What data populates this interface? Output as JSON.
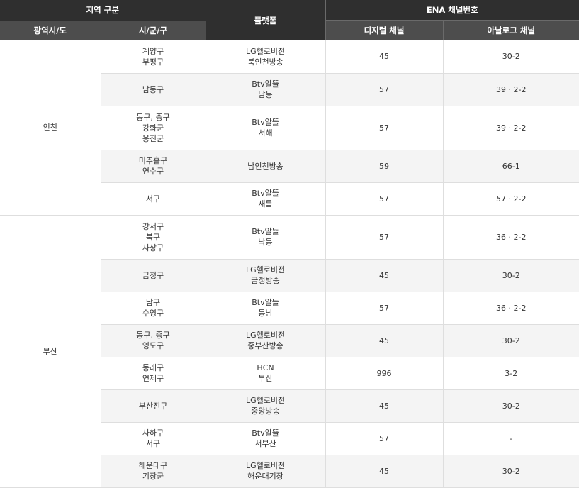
{
  "header": {
    "region_group": "지역 구분",
    "platform": "플랫폼",
    "channel_group": "ENA 채널번호",
    "province": "광역시/도",
    "district": "시/군/구",
    "digital": "디지털 채널",
    "analog": "아날로그 채널"
  },
  "regions": [
    {
      "name": "인천",
      "rows": [
        {
          "district": [
            "계양구",
            "부평구"
          ],
          "platform": [
            "LG헬로비전",
            "북인천방송"
          ],
          "digital": "45",
          "analog": "30-2"
        },
        {
          "district": [
            "남동구"
          ],
          "platform": [
            "Btv알뜰",
            "남동"
          ],
          "digital": "57",
          "analog": "39 · 2-2"
        },
        {
          "district": [
            "동구, 중구",
            "강화군",
            "옹진군"
          ],
          "platform": [
            "Btv알뜰",
            "서해"
          ],
          "digital": "57",
          "analog": "39 · 2-2"
        },
        {
          "district": [
            "미추홀구",
            "연수구"
          ],
          "platform": [
            "남인천방송"
          ],
          "digital": "59",
          "analog": "66-1"
        },
        {
          "district": [
            "서구"
          ],
          "platform": [
            "Btv알뜰",
            "새롬"
          ],
          "digital": "57",
          "analog": "57 · 2-2"
        }
      ]
    },
    {
      "name": "부산",
      "rows": [
        {
          "district": [
            "강서구",
            "북구",
            "사상구"
          ],
          "platform": [
            "Btv알뜰",
            "낙동"
          ],
          "digital": "57",
          "analog": "36 · 2-2"
        },
        {
          "district": [
            "금정구"
          ],
          "platform": [
            "LG헬로비전",
            "금정방송"
          ],
          "digital": "45",
          "analog": "30-2"
        },
        {
          "district": [
            "남구",
            "수영구"
          ],
          "platform": [
            "Btv알뜰",
            "동남"
          ],
          "digital": "57",
          "analog": "36 · 2-2"
        },
        {
          "district": [
            "동구, 중구",
            "영도구"
          ],
          "platform": [
            "LG헬로비전",
            "중부산방송"
          ],
          "digital": "45",
          "analog": "30-2"
        },
        {
          "district": [
            "동래구",
            "연제구"
          ],
          "platform": [
            "HCN",
            "부산"
          ],
          "digital": "996",
          "analog": "3-2"
        },
        {
          "district": [
            "부산진구"
          ],
          "platform": [
            "LG헬로비전",
            "중앙방송"
          ],
          "digital": "45",
          "analog": "30-2"
        },
        {
          "district": [
            "사하구",
            "서구"
          ],
          "platform": [
            "Btv알뜰",
            "서부산"
          ],
          "digital": "57",
          "analog": "-"
        },
        {
          "district": [
            "해운대구",
            "기장군"
          ],
          "platform": [
            "LG헬로비전",
            "해운대기장"
          ],
          "digital": "45",
          "analog": "30-2"
        }
      ]
    }
  ]
}
